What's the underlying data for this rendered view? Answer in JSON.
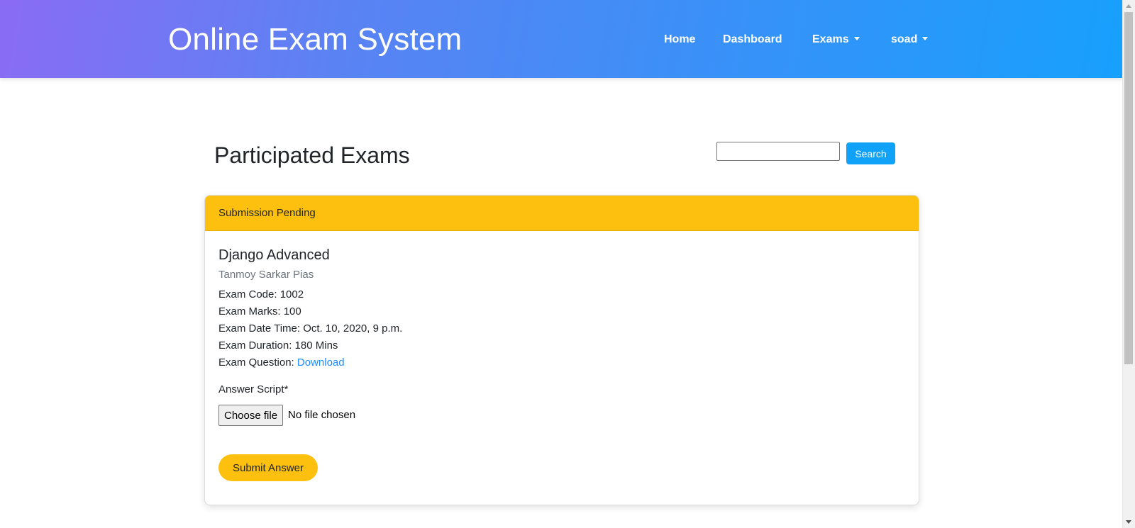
{
  "app": {
    "brand": "Online Exam System"
  },
  "nav": {
    "home": "Home",
    "dashboard": "Dashboard",
    "exams": "Exams",
    "user": "soad"
  },
  "page": {
    "title": "Participated Exams"
  },
  "search": {
    "value": "",
    "placeholder": "",
    "button_label": "Search"
  },
  "card": {
    "status": "Submission Pending",
    "exam_title": "Django Advanced",
    "teacher": "Tanmoy Sarkar Pias",
    "code_label": "Exam Code: ",
    "code": "1002",
    "marks_label": "Exam Marks: ",
    "marks": "100",
    "datetime_label": "Exam Date Time: ",
    "datetime": "Oct. 10, 2020, 9 p.m.",
    "duration_label": "Exam Duration: ",
    "duration": "180 Mins",
    "question_label": "Exam Question: ",
    "question_link": "Download",
    "answer_label": "Answer Script*",
    "file_button": "Choose file",
    "file_status": "No file chosen",
    "submit_label": "Submit Answer"
  },
  "colors": {
    "header_gradient_start": "#8a6cf4",
    "header_gradient_end": "#17a0fd",
    "accent_yellow": "#fdc00f",
    "search_blue": "#10a2f8",
    "link_blue": "#1a8cff"
  },
  "icons": {
    "dropdown": "caret-down-icon"
  }
}
